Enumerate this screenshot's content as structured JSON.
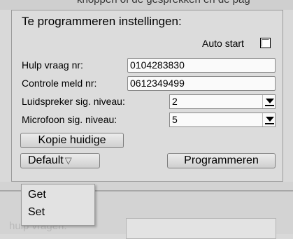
{
  "header_partial_text": "knoppen of de gesprekken en de pag",
  "panel": {
    "title": "Te programmeren instellingen:",
    "auto_start_label": "Auto start",
    "auto_start_checked": false,
    "hulp_vraag_label": "Hulp vraag nr:",
    "hulp_vraag_value": "0104283830",
    "controle_meld_label": "Controle meld nr:",
    "controle_meld_value": "0612349499",
    "luidspreker_label": "Luidspreker sig. niveau:",
    "luidspreker_value": "2",
    "microfoon_label": "Microfoon sig. niveau:",
    "microfoon_value": "5",
    "kopie_button": "Kopie huidige",
    "default_button": "Default",
    "default_arrow": "▽",
    "programmeren_button": "Programmeren"
  },
  "dropdown_menu": {
    "items": [
      "Get",
      "Set"
    ]
  },
  "background_partial_text": "hulp vragen:"
}
